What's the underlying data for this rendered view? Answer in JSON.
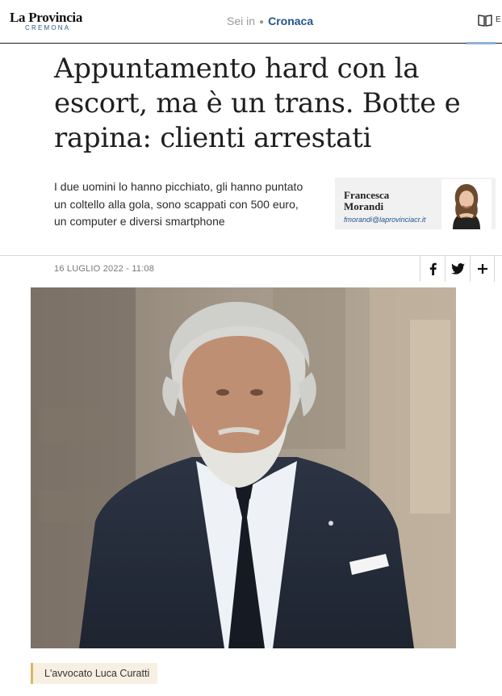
{
  "header": {
    "logo_main": "La Provincia",
    "logo_sub": "CREMONA",
    "breadcrumb_prefix": "Sei in",
    "breadcrumb_section": "Cronaca",
    "edge_letter": "E",
    "icons": [
      "book-icon"
    ]
  },
  "article": {
    "title": "Appuntamento hard con la escort, ma è un trans. Botte e rapina: clienti arrestati",
    "summary": "I due uomini lo hanno picchiato, gli hanno puntato un coltello alla gola, sono scappati con 500 euro, un computer e diversi smartphone",
    "date": "16 LUGLIO 2022 - 11:08",
    "caption": "L'avvocato Luca Curatti"
  },
  "author": {
    "name": "Francesca Morandi",
    "email": "fmorandi@laprovinciacr.it"
  },
  "share": {
    "icons": [
      "facebook-icon",
      "twitter-icon",
      "plus-icon"
    ]
  },
  "colors": {
    "brand_blue": "#1f5590",
    "accent_gold": "#d8b869",
    "caption_bg": "#f7f0e2",
    "card_bg": "#f1f1f1"
  }
}
